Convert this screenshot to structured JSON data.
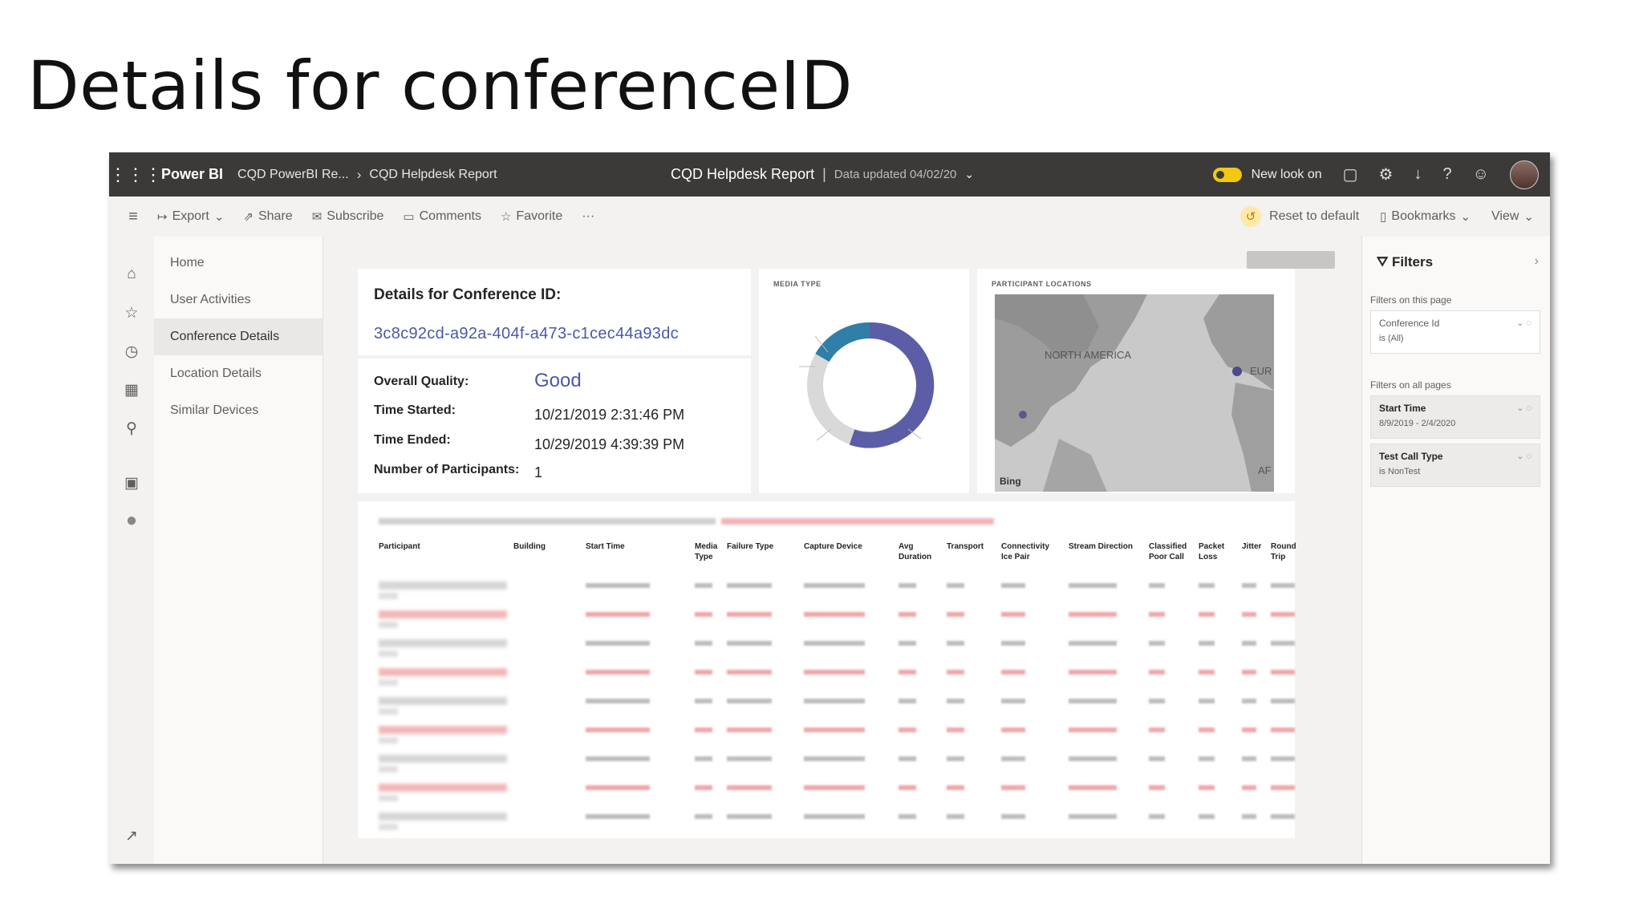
{
  "slide_title": "Details for conferenceID",
  "topbar": {
    "brand": "Power BI",
    "breadcrumb_workspace": "CQD PowerBI Re...",
    "breadcrumb_report": "CQD Helpdesk Report",
    "report_title": "CQD Helpdesk Report",
    "data_updated": "Data updated 04/02/20",
    "new_look": "New look on"
  },
  "actionbar": {
    "export": "Export",
    "share": "Share",
    "subscribe": "Subscribe",
    "comments": "Comments",
    "favorite": "Favorite",
    "more": "···",
    "reset": "Reset to default",
    "bookmarks": "Bookmarks",
    "view": "View"
  },
  "pages": [
    "Home",
    "User Activities",
    "Conference Details",
    "Location Details",
    "Similar Devices"
  ],
  "active_page": "Conference Details",
  "details": {
    "heading": "Details for Conference ID:",
    "conference_id": "3c8c92cd-a92a-404f-a473-c1cec44a93dc",
    "overall_quality_label": "Overall Quality:",
    "overall_quality_value": "Good",
    "time_started_label": "Time Started:",
    "time_started_value": "10/21/2019 2:31:46 PM",
    "time_ended_label": "Time Ended:",
    "time_ended_value": "10/29/2019 4:39:39 PM",
    "participants_label": "Number of Participants:",
    "participants_value": "1"
  },
  "media_card": {
    "title": "MEDIA TYPE"
  },
  "map_card": {
    "title": "PARTICIPANT LOCATIONS",
    "label_na": "NORTH AMERICA",
    "label_eu": "EUR",
    "label_af": "AF",
    "bing": "Bing"
  },
  "table": {
    "columns": [
      "Participant",
      "Building",
      "Start Time",
      "Media Type",
      "Failure Type",
      "Capture Device",
      "Avg Duration",
      "Transport",
      "Connectivity Ice Pair",
      "Stream Direction",
      "Classified Poor Call",
      "Packet Loss",
      "Jitter",
      "Round Trip"
    ]
  },
  "filters": {
    "title": "Filters",
    "on_this_page": "Filters on this page",
    "on_all_pages": "Filters on all pages",
    "page_filter_name": "Conference Id",
    "page_filter_value": "is (All)",
    "f1_name": "Start Time",
    "f1_value": "8/9/2019 - 2/4/2020",
    "f2_name": "Test Call Type",
    "f2_value": "is NonTest"
  }
}
